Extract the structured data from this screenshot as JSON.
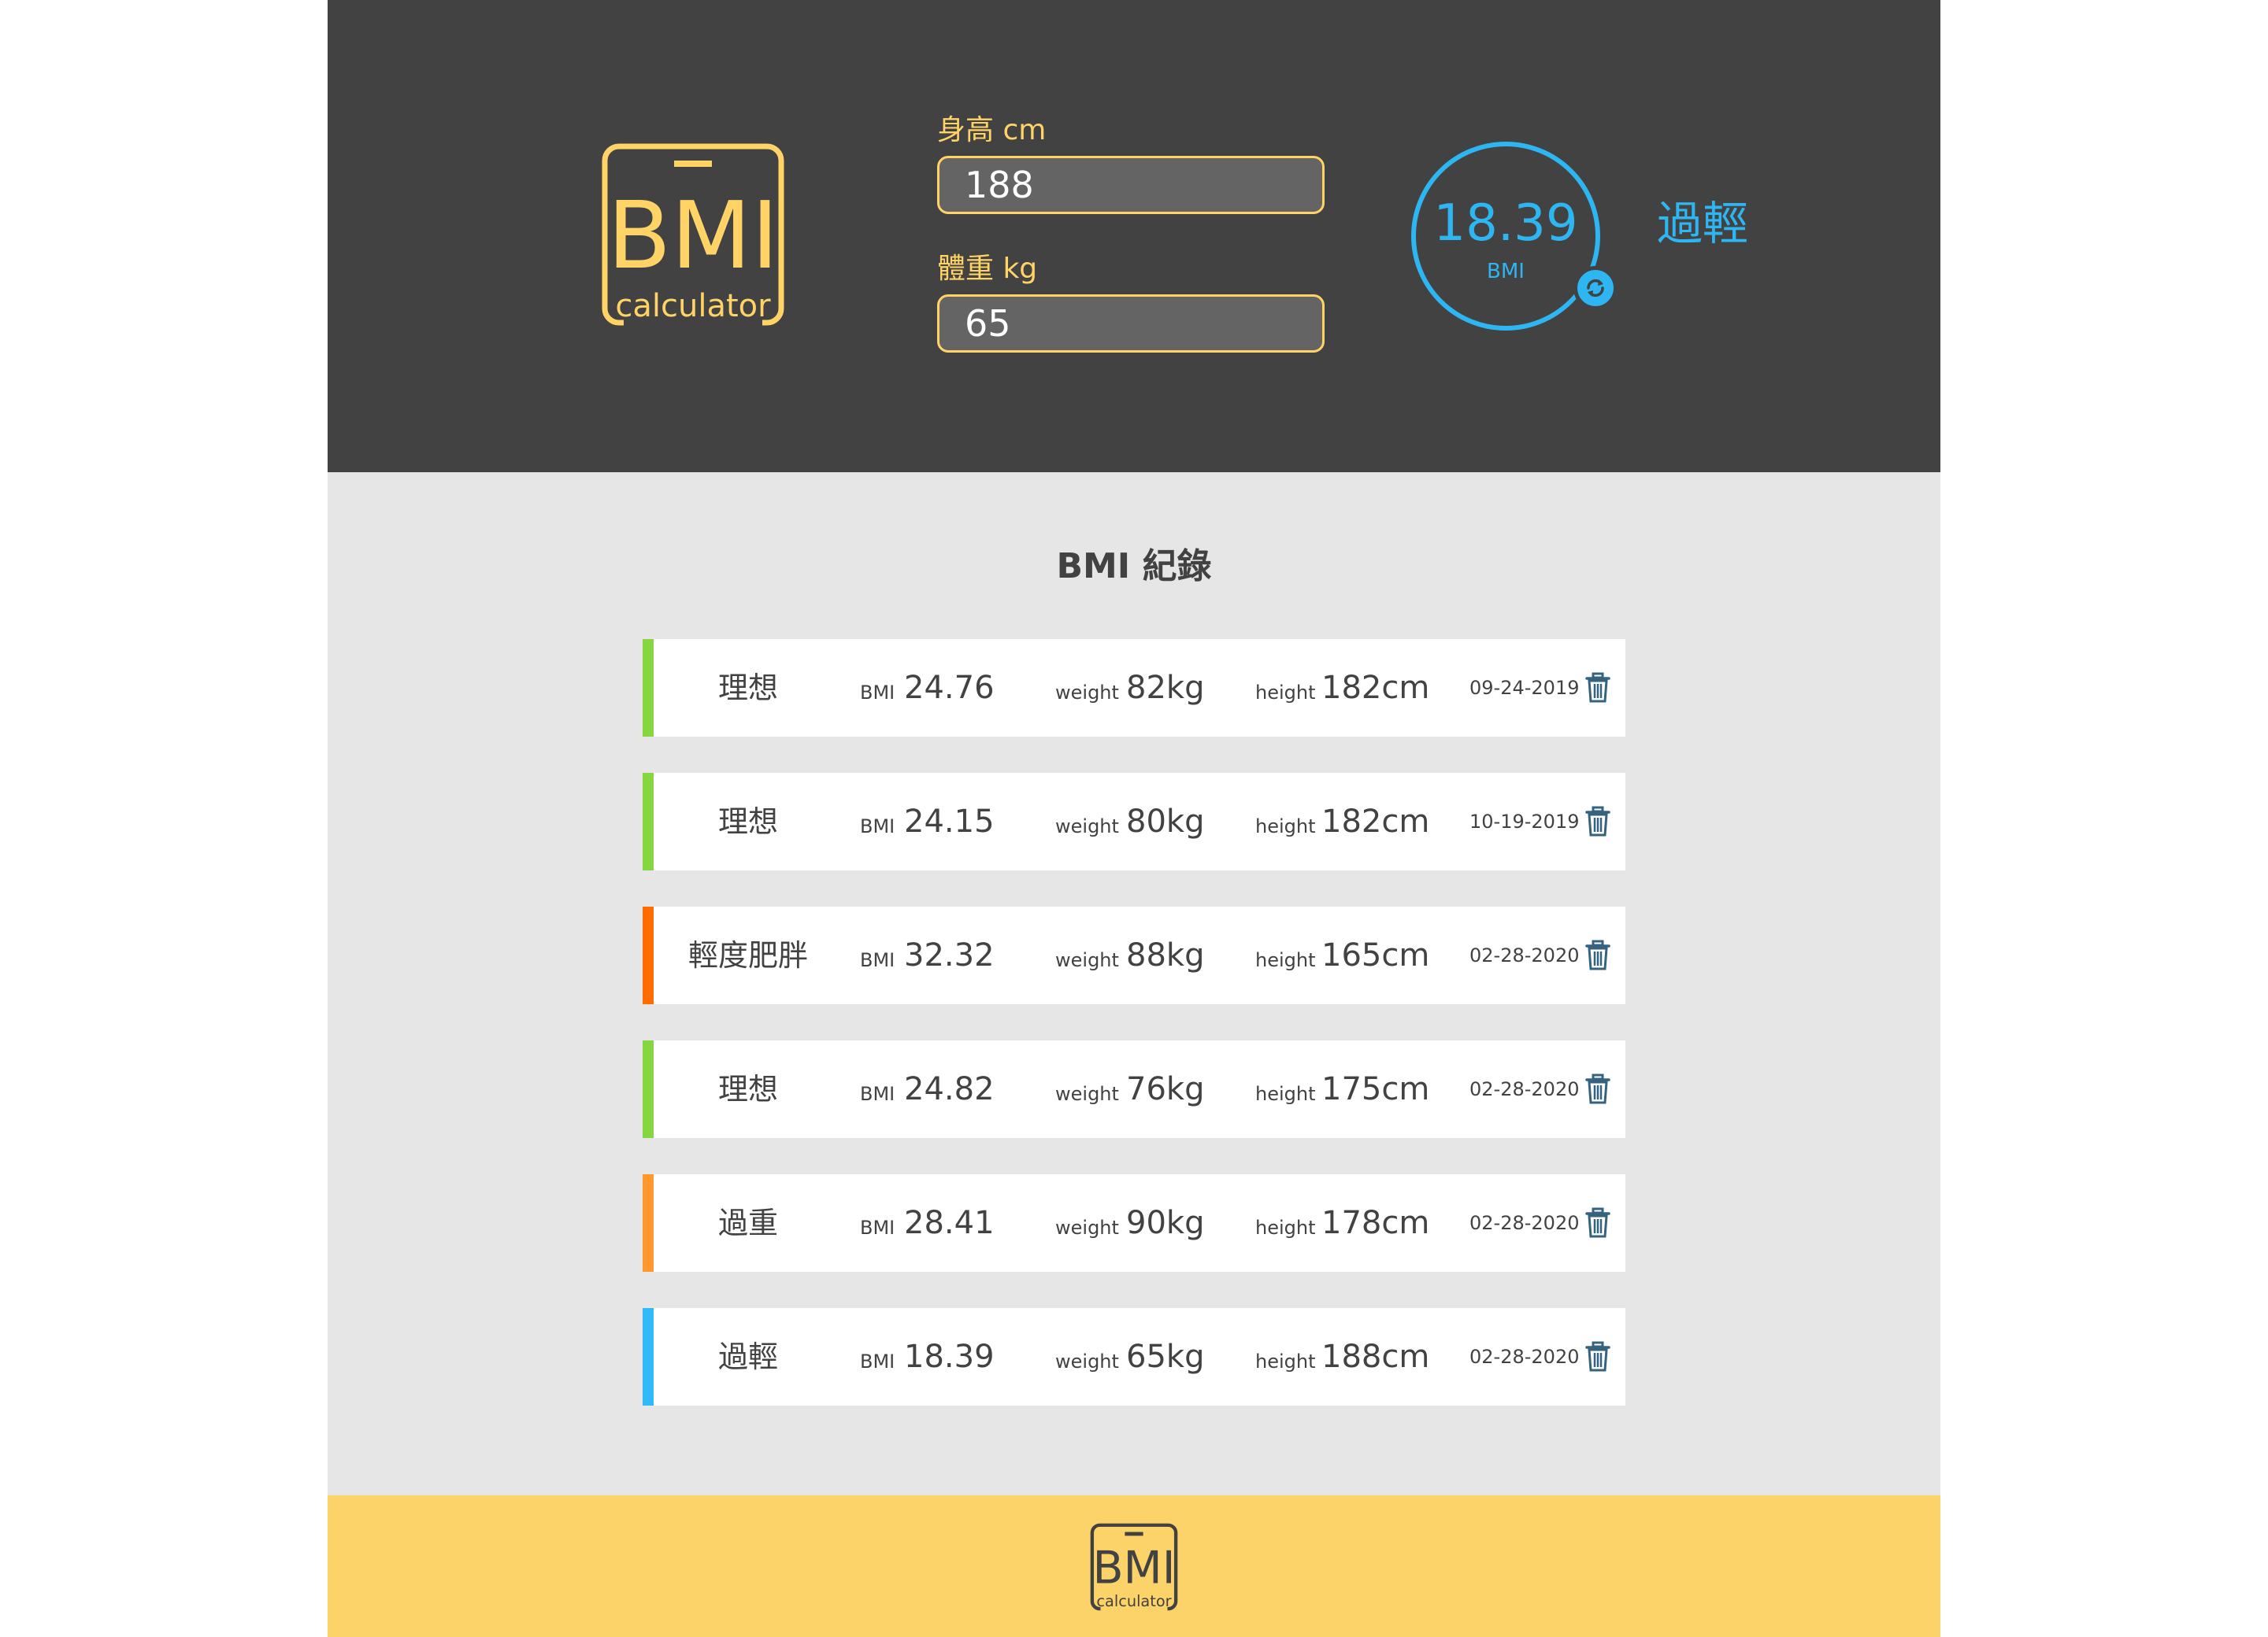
{
  "logo": {
    "brand": "BMI",
    "sub": "calculator"
  },
  "form": {
    "height_label": "身高 cm",
    "height_value": "188",
    "weight_label": "體重 kg",
    "weight_value": "65"
  },
  "result": {
    "value": "18.39",
    "unit": "BMI",
    "status": "過輕",
    "color": "#2db6f1",
    "refresh_icon": "refresh-icon"
  },
  "records": {
    "title": "BMI 紀錄",
    "bmi_label": "BMI",
    "weight_label": "weight",
    "height_label": "height",
    "delete_icon": "trash-icon",
    "items": [
      {
        "status": "理想",
        "bmi": "24.76",
        "weight": "82kg",
        "height": "182cm",
        "date": "09-24-2019",
        "color": "#86d73f"
      },
      {
        "status": "理想",
        "bmi": "24.15",
        "weight": "80kg",
        "height": "182cm",
        "date": "10-19-2019",
        "color": "#86d73f"
      },
      {
        "status": "輕度肥胖",
        "bmi": "32.32",
        "weight": "88kg",
        "height": "165cm",
        "date": "02-28-2020",
        "color": "#ff6c02"
      },
      {
        "status": "理想",
        "bmi": "24.82",
        "weight": "76kg",
        "height": "175cm",
        "date": "02-28-2020",
        "color": "#86d73f"
      },
      {
        "status": "過重",
        "bmi": "28.41",
        "weight": "90kg",
        "height": "178cm",
        "date": "02-28-2020",
        "color": "#ff982d"
      },
      {
        "status": "過輕",
        "bmi": "18.39",
        "weight": "65kg",
        "height": "188cm",
        "date": "02-28-2020",
        "color": "#31baf9"
      }
    ]
  },
  "theme": {
    "header_bg": "#424242",
    "accent_yellow": "#ffd366",
    "section_bg": "#e6e6e6",
    "footer_bg": "#fcd368"
  }
}
